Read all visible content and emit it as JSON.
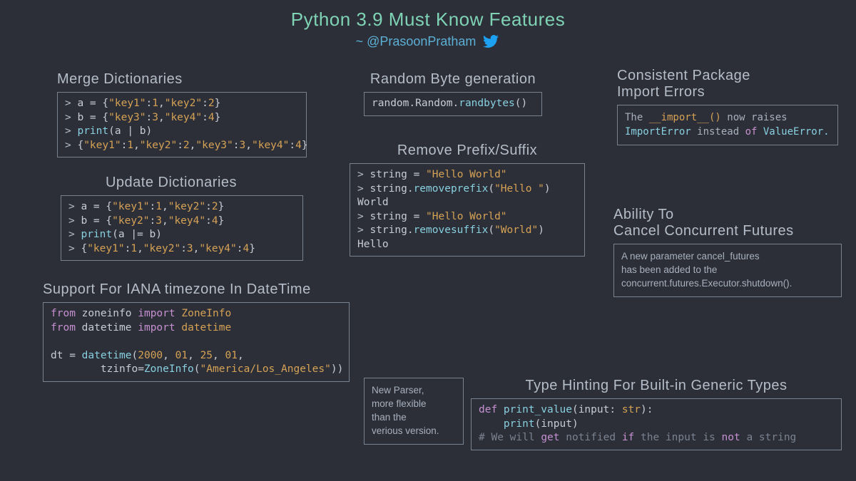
{
  "title": "Python 3.9 Must Know Features",
  "byline": "~ @PrasoonPratham",
  "merge": {
    "title": "Merge Dictionaries",
    "l1_prompt": "> ",
    "l1_a": "a = {",
    "l1_k1": "\"key1\"",
    "l1_c1": ":",
    "l1_n1": "1",
    "l1_c2": ",",
    "l1_k2": "\"key2\"",
    "l1_c3": ":",
    "l1_n2": "2",
    "l1_e": "}",
    "l2_a": "b = {",
    "l2_k1": "\"key3\"",
    "l2_n1": "3",
    "l2_k2": "\"key4\"",
    "l2_n2": "4",
    "l3_a": "print",
    "l3_b": "(a | b)",
    "l4_a": "{",
    "l4_k1": "\"key1\"",
    "l4_n1": "1",
    "l4_k2": "\"key2\"",
    "l4_n2": "2",
    "l4_k3": "\"key3\"",
    "l4_n3": "3",
    "l4_k4": "\"key4\"",
    "l4_n4": "4"
  },
  "update": {
    "title": "Update Dictionaries",
    "l1_a": "a = {",
    "l2_a": "b = {",
    "l2_k1": "\"key2\"",
    "l2_n1": "3",
    "l2_k2": "\"key4\"",
    "l2_n2": "4",
    "l3_a": "print",
    "l3_b": "(a |= b)",
    "l4_k1": "\"key1\"",
    "l4_n1": "1",
    "l4_k2": "\"key2\"",
    "l4_n2": "3",
    "l4_k3": "\"key4\"",
    "l4_n3": "4"
  },
  "iana": {
    "title": "Support For IANA timezone In DateTime",
    "l1_from": "from",
    "l1_mod": " zoneinfo ",
    "l1_imp": "import",
    "l1_obj": " ZoneInfo",
    "l2_mod": " datetime ",
    "l2_obj": " datetime",
    "l4_a": "dt = ",
    "l4_fn": "datetime",
    "l4_b": "(",
    "l4_n1": "2000",
    "l4_n2": "01",
    "l4_n3": "25",
    "l4_n4": "01",
    "l5_a": "        tzinfo=",
    "l5_fn": "ZoneInfo",
    "l5_b": "(",
    "l5_s": "\"America/Los_Angeles\"",
    "l5_c": "))"
  },
  "randbyte": {
    "title": "Random Byte generation",
    "code_a": "random.Random.",
    "code_b": "randbytes",
    "code_c": "()"
  },
  "prefix": {
    "title": "Remove Prefix/Suffix",
    "l1_a": "string = ",
    "l1_s": "\"Hello World\"",
    "l2_a": "string.",
    "l2_fn": "removeprefix",
    "l2_b": "(",
    "l2_s": "\"Hello \"",
    "l2_c": ")",
    "l3": "World",
    "l4_a": "string = ",
    "l4_s": "\"Hello World\"",
    "l5_fn": "removesuffix",
    "l5_s": "\"World\"",
    "l6": "Hello"
  },
  "consistent": {
    "title_l1": "Consistent Package",
    "title_l2": "Import Errors",
    "note_a": "The ",
    "note_b": "__import__() ",
    "note_c": "now raises\n",
    "note_d": "ImportError",
    "note_e": " instead ",
    "note_of": "of",
    "note_f": " ValueError.",
    "note_g": ""
  },
  "cancelcf": {
    "title_l1": "Ability To",
    "title_l2": "Cancel Concurrent Futures",
    "note": "A new parameter cancel_futures\nhas been added to the\nconcurrent.futures.Executor.shutdown()."
  },
  "parser": {
    "note": "New Parser,\nmore flexible\nthan the\nverious version."
  },
  "typehint": {
    "title": "Type Hinting For Built-in Generic Types",
    "l1_def": "def",
    "l1_fn": " print_value",
    "l1_a": "(input: ",
    "l1_type": "str",
    "l1_b": "):",
    "l2_a": "    ",
    "l2_fn": "print",
    "l2_b": "(input)",
    "l3_a": "# We will ",
    "l3_get": "get",
    "l3_b": " notified ",
    "l3_if": "if",
    "l3_c": " the input is ",
    "l3_not": "not",
    "l3_d": " a string"
  }
}
